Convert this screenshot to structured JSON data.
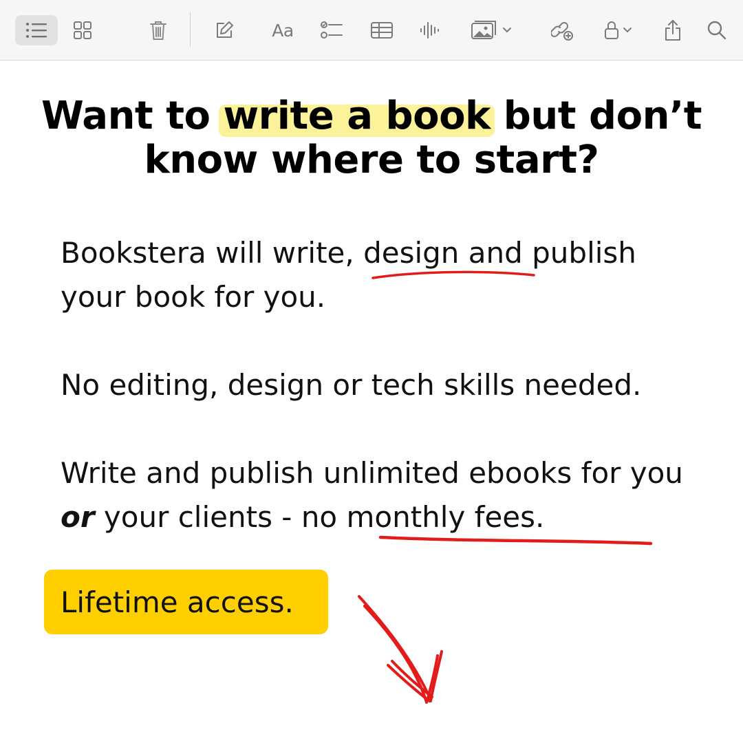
{
  "toolbar": {
    "font_button_label": "Aa"
  },
  "note": {
    "headline_pre": "Want to ",
    "headline_highlight": "write a book",
    "headline_post_line1": " but don’t",
    "headline_line2": "know where to start?",
    "p1_pre": "Bookstera will write, ",
    "p1_underlined": "design and",
    "p1_post": " publish your book for you.",
    "p2": "No editing, design or tech skills needed.",
    "p3_pre": "Write and publish unlimited ebooks for you ",
    "p3_emphasis": "or",
    "p3_mid": " your clients - ",
    "p3_underlined": "no monthly fees.",
    "cta_label": "Lifetime access."
  },
  "colors": {
    "highlight": "#fbf29a",
    "cta_background": "#ffcf00",
    "annotation_red": "#e21b1b"
  }
}
